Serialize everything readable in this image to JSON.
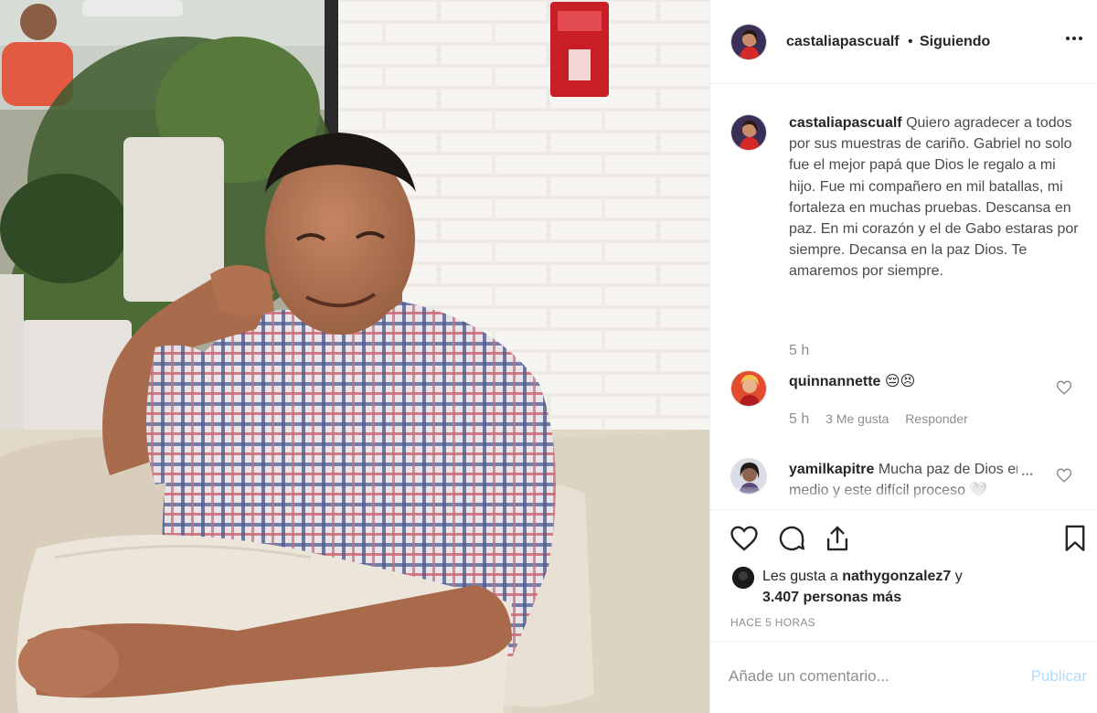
{
  "post": {
    "photo_alt": "Hombre sonriente con camisa a cuadros sentado en un sofá",
    "author": "castaliapascualf",
    "separator": "•",
    "follow_status": "Siguiendo",
    "more_icon": "more-options-icon",
    "caption": {
      "username": "castaliapascualf",
      "text": "Quiero agradecer a todos por sus muestras de cariño. Gabriel no solo fue el mejor papá que Dios le regalo a mi hijo. Fue mi compañero en mil batallas, mi fortaleza en muchas pruebas. Descansa en paz. En mi corazón y el de Gabo estaras por siempre. Decansa en la paz Dios. Te amaremos por siempre.",
      "time": "5 h"
    },
    "comments": [
      {
        "username": "quinnannette",
        "text": "😔😣",
        "time": "5 h",
        "likes": "3 Me gusta",
        "reply": "Responder"
      },
      {
        "username": "yamilkapitre",
        "text": "Mucha paz de Dios en medio y este difícil proceso 🤍",
        "more": "..."
      }
    ],
    "likes": {
      "prefix": "Les gusta a",
      "user": "nathygonzalez7",
      "conj": "y",
      "count": "3.407 personas más"
    },
    "time_ago": "HACE 5 HORAS",
    "comment_box": {
      "placeholder": "Añade un comentario...",
      "publish_label": "Publicar"
    }
  },
  "colors": {
    "primary_text": "#262626",
    "secondary_text": "#8e8e8e",
    "border": "#efefef",
    "publish_disabled": "#b3dbff"
  }
}
